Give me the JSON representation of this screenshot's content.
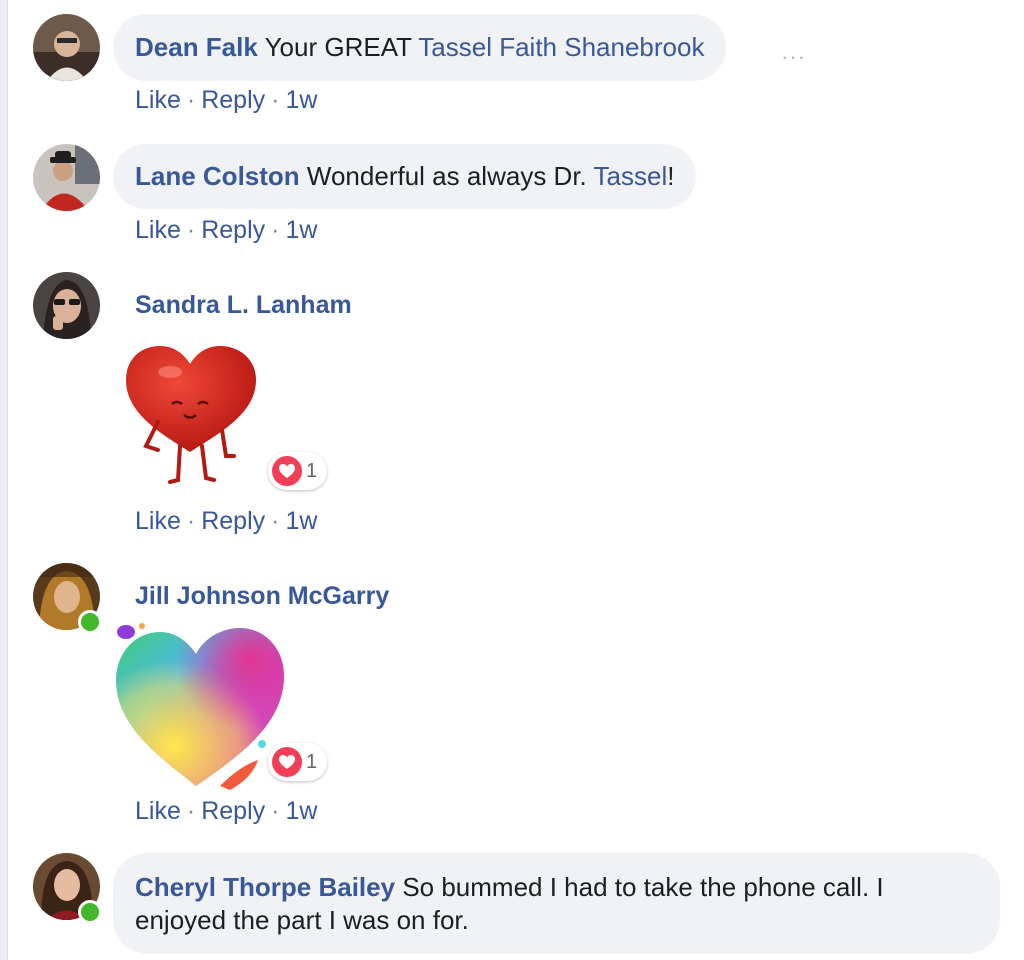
{
  "comments": [
    {
      "author": "Dean Falk",
      "text_1": "Your GREAT",
      "mention": "Tassel Faith Shanebrook",
      "actions": {
        "like": "Like",
        "reply": "Reply",
        "sep": "·",
        "time": "1w"
      }
    },
    {
      "author": "Lane Colston",
      "text_1": "Wonderful as always Dr.",
      "mention": "Tassel",
      "text_2": "!",
      "actions": {
        "like": "Like",
        "reply": "Reply",
        "sep": "·",
        "time": "1w"
      }
    },
    {
      "author": "Sandra L. Lanham",
      "sticker": "red-heart-character-sticker",
      "reaction": {
        "icon": "love-icon",
        "count": "1"
      },
      "actions": {
        "like": "Like",
        "reply": "Reply",
        "sep": "·",
        "time": "1w"
      }
    },
    {
      "author": "Jill Johnson McGarry",
      "online": true,
      "sticker": "rainbow-heart-sticker",
      "reaction": {
        "icon": "love-icon",
        "count": "1"
      },
      "actions": {
        "like": "Like",
        "reply": "Reply",
        "sep": "·",
        "time": "1w"
      }
    },
    {
      "author": "Cheryl Thorpe Bailey",
      "online": true,
      "text_line_1": "So bummed I had to take the phone call. I",
      "text_line_2": "enjoyed the part I was on for."
    }
  ],
  "more_options": "···",
  "colors": {
    "link": "#385898",
    "bubble": "#f0f2f5",
    "online": "#42b72a",
    "love": "#f33e58"
  }
}
